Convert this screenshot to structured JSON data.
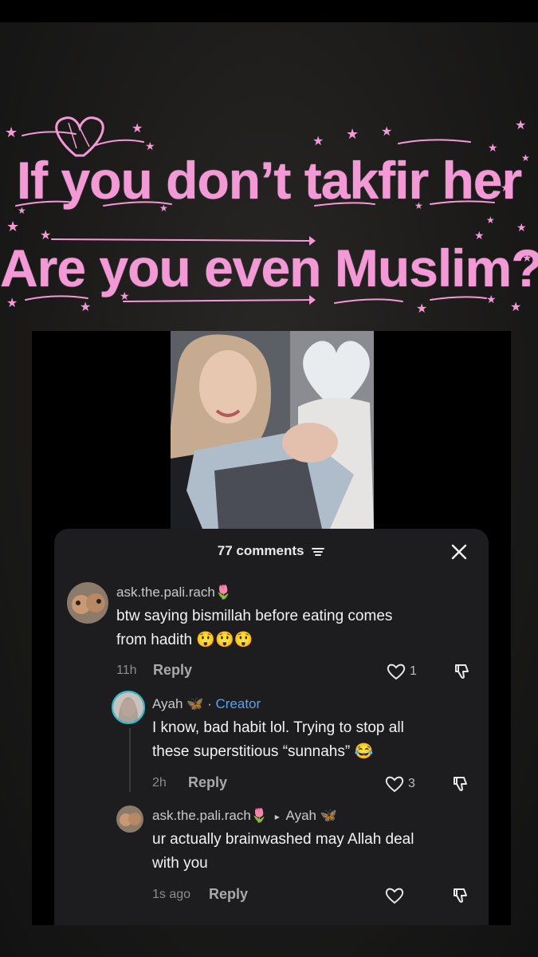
{
  "headline": {
    "line1": "If you don’t takfir her",
    "line2": "Are you even Muslim?",
    "color": "#f39ad6"
  },
  "sheet": {
    "comments_count": "77 comments",
    "filter_icon": "filter-icon",
    "close_icon": "close-icon"
  },
  "comments": [
    {
      "username": "ask.the.pali.rach🌷",
      "text_line1": "btw saying bismillah before eating comes",
      "text_line2": "from hadith 😲😲😲",
      "time": "11h",
      "reply": "Reply",
      "likes": "1"
    },
    {
      "username": "Ayah 🦋",
      "separator": "·",
      "badge": "Creator",
      "text_line1": "I know, bad habit lol. Trying to stop all",
      "text_line2": "these superstitious “sunnahs” 😂",
      "time": "2h",
      "reply": "Reply",
      "likes": "3"
    },
    {
      "username": "ask.the.pali.rach🌷",
      "reply_to_arrow": "▸",
      "reply_to": "Ayah 🦋",
      "text_line1": "ur actually brainwashed may Allah deal",
      "text_line2": "with you",
      "time": "1s ago",
      "reply": "Reply",
      "likes": ""
    }
  ]
}
